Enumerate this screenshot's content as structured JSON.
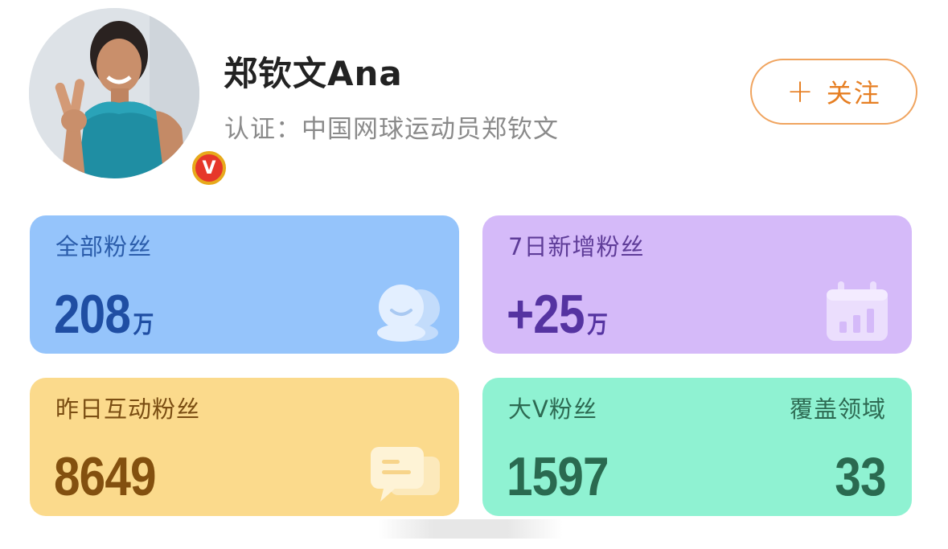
{
  "profile": {
    "name": "郑钦文Ana",
    "verification": "认证：中国网球运动员郑钦文",
    "badge": "V",
    "follow_plus": "+",
    "follow_label": "关注"
  },
  "stats": [
    {
      "label": "全部粉丝",
      "value": "208",
      "unit": "万",
      "icon": "fans-icon"
    },
    {
      "label": "7日新增粉丝",
      "value": "+25",
      "unit": "万",
      "icon": "calendar-chart-icon"
    },
    {
      "label": "昨日互动粉丝",
      "value": "8649",
      "unit": "",
      "icon": "comment-icon"
    },
    {
      "label": "大V粉丝",
      "value": "1597",
      "label_right": "覆盖领域",
      "value_right": "33"
    }
  ],
  "colors": {
    "follow_accent": "#e67e22",
    "card_blue": "#95c4fb",
    "card_purple": "#d5baf9",
    "card_yellow": "#fbda8c",
    "card_green": "#8ff2d2",
    "badge_red": "#e6372a"
  }
}
